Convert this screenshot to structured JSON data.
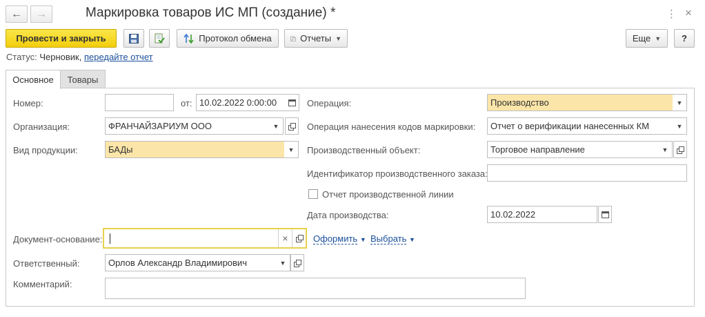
{
  "window": {
    "title": "Маркировка товаров ИС МП (создание) *",
    "back_icon": "←",
    "forward_icon": "→",
    "more_icon": "⋮",
    "close_icon": "×"
  },
  "toolbar": {
    "post_close": "Провести и закрыть",
    "exchange_log": "Протокол обмена",
    "reports": "Отчеты",
    "more": "Еще",
    "help": "?"
  },
  "status": {
    "label": "Статус:",
    "value": "Черновик,",
    "link": "передайте отчет"
  },
  "tabs": [
    {
      "label": "Основное",
      "active": true
    },
    {
      "label": "Товары",
      "active": false
    }
  ],
  "form": {
    "number": {
      "label": "Номер:",
      "value": ""
    },
    "date": {
      "label": "от:",
      "value": "10.02.2022  0:00:00"
    },
    "organization": {
      "label": "Организация:",
      "value": "ФРАНЧАЙЗАРИУМ ООО"
    },
    "product_kind": {
      "label": "Вид продукции:",
      "value": "БАДы"
    },
    "operation": {
      "label": "Операция:",
      "value": "Производство"
    },
    "marking_operation": {
      "label": "Операция нанесения кодов маркировки:",
      "value": "Отчет о верификации нанесенных КМ"
    },
    "production_object": {
      "label": "Производственный объект:",
      "value": "Торговое направление"
    },
    "production_order_id": {
      "label": "Идентификатор производственного заказа:",
      "value": ""
    },
    "production_line_report": {
      "label": "Отчет производственной линии",
      "checked": false
    },
    "production_date": {
      "label": "Дата производства:",
      "value": "10.02.2022"
    },
    "base_document": {
      "label": "Документ-основание:",
      "value": "",
      "action_issue": "Оформить",
      "action_select": "Выбрать"
    },
    "responsible": {
      "label": "Ответственный:",
      "value": "Орлов Александр Владимирович"
    },
    "comment": {
      "label": "Комментарий:",
      "value": ""
    }
  },
  "colors": {
    "primary_button": "#f5d41a",
    "highlight_field": "#fbe5a8",
    "link": "#1a4f9b"
  }
}
